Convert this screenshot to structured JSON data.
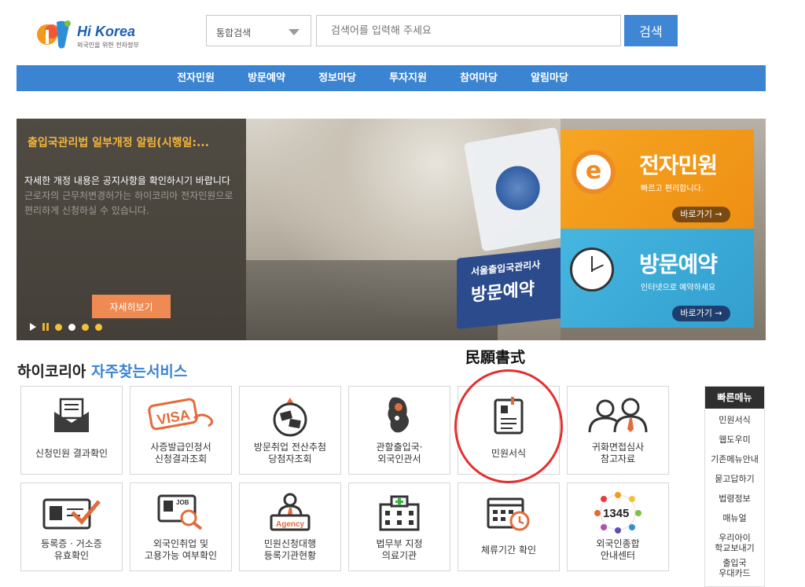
{
  "header": {
    "logo_text": "Hi Korea",
    "logo_sub": "외국인을 위한 전자정부",
    "search_select": "통합검색",
    "search_placeholder": "검색어를 입력해 주세요",
    "search_button": "검색"
  },
  "nav": {
    "items": [
      "전자민원",
      "방문예약",
      "정보마당",
      "투자지원",
      "참여마당",
      "알림마당"
    ]
  },
  "banner": {
    "headline": "출입국관리법 일부개정 알림(시행일:...",
    "desc_main": "자세한 개정 내용은 공지사항을 확인하시기 바랍니다",
    "desc_faded": "근로자의 근무처변경허가는 하이코리아 전자민원으로 편리하게 신청하실 수 있습니다.",
    "more_button": "자세히보기",
    "sign_line1": "서울출입국관리사",
    "sign_line2": "방문예약",
    "card_e": {
      "icon": "e",
      "title": "전자민원",
      "sub": "빠르고 편리합니다.",
      "go": "바로가기 →"
    },
    "card_v": {
      "title": "방문예약",
      "sub": "인터넷으로 예약하세요",
      "go": "바로가기 →"
    }
  },
  "section": {
    "hanja_annotation": "民願書式",
    "title_plain": "하이코리아",
    "title_accent": "자주찾는서비스"
  },
  "tiles": [
    {
      "label": "신청민원 결과확인",
      "icon": "envelope-list-icon"
    },
    {
      "label": "사증발급인정서\n신청결과조회",
      "icon": "visa-stamp-icon"
    },
    {
      "label": "방문취업 전산추첨\n당첨자조회",
      "icon": "lottery-ball-icon"
    },
    {
      "label": "관할출입국·\n외국인관서",
      "icon": "korea-map-icon"
    },
    {
      "label": "민원서식",
      "icon": "document-form-icon"
    },
    {
      "label": "귀화면접심사\n참고자료",
      "icon": "interview-people-icon"
    },
    {
      "label": "등록증 · 거소증\n유효확인",
      "icon": "id-card-check-icon"
    },
    {
      "label": "외국인취업 및\n고용가능 여부확인",
      "icon": "job-search-icon"
    },
    {
      "label": "민원신청대행\n등록기관현황",
      "icon": "agency-icon"
    },
    {
      "label": "법무부 지정\n의료기관",
      "icon": "hospital-icon"
    },
    {
      "label": "체류기간 확인",
      "icon": "calendar-clock-icon"
    },
    {
      "label": "외국인종합\n안내센터",
      "icon": "call-center-1345-icon"
    }
  ],
  "tile_1345": "1345",
  "quick_menu": {
    "title": "빠른메뉴",
    "items": [
      "민원서식",
      "웹도우미",
      "기존메뉴안내",
      "묻고답하기",
      "법령정보",
      "매뉴얼",
      "우리아이\n학교보내기",
      "출입국\n우대카드"
    ]
  }
}
